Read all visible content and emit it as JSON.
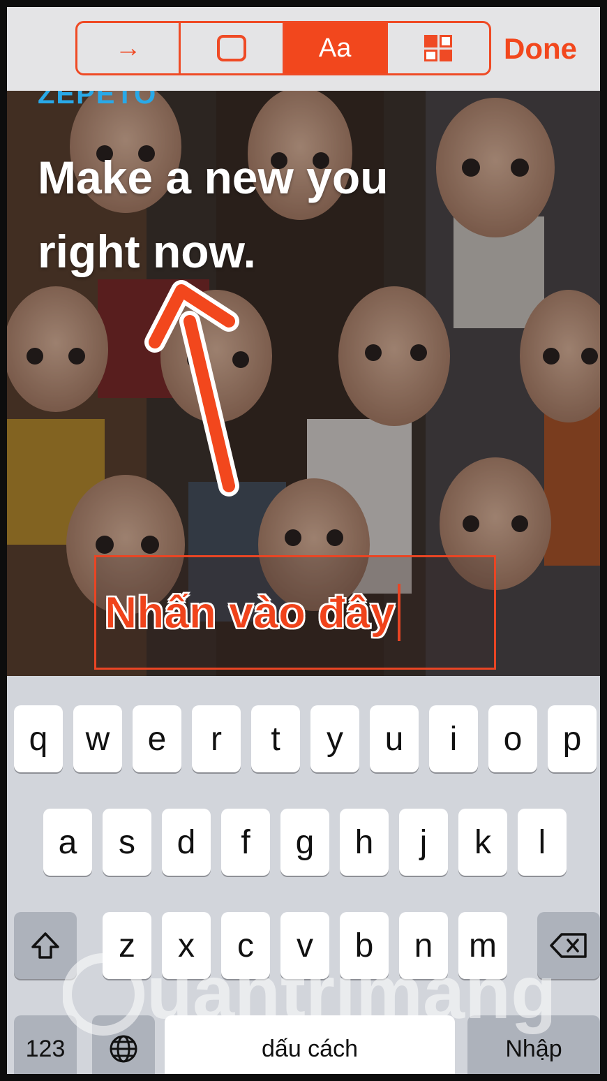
{
  "toolbar": {
    "buttons": [
      {
        "id": "arrow",
        "label": "→",
        "icon": "arrow-icon",
        "active": false
      },
      {
        "id": "box",
        "label": "",
        "icon": "rectangle-icon",
        "active": false
      },
      {
        "id": "text",
        "label": "Aa",
        "icon": "text-icon",
        "active": true
      },
      {
        "id": "pixelate",
        "label": "",
        "icon": "pixelate-icon",
        "active": false
      }
    ],
    "done_label": "Done"
  },
  "canvas": {
    "brand_text": "ZEPETO",
    "headline_line1": "Make a new you",
    "headline_line2": "right now.",
    "annotation_text": "Nhấn vào đây"
  },
  "keyboard": {
    "row1": [
      "q",
      "w",
      "e",
      "r",
      "t",
      "y",
      "u",
      "i",
      "o",
      "p"
    ],
    "row2": [
      "a",
      "s",
      "d",
      "f",
      "g",
      "h",
      "j",
      "k",
      "l"
    ],
    "row3": [
      "z",
      "x",
      "c",
      "v",
      "b",
      "n",
      "m"
    ],
    "numbers_label": "123",
    "space_label": "dấu cách",
    "return_label": "Nhập",
    "shift_icon": "shift-icon",
    "delete_icon": "backspace-icon",
    "globe_icon": "globe-icon"
  },
  "watermark_text": "uantrimang",
  "colors": {
    "accent": "#f2471d",
    "brand_blue": "#29a9e8",
    "keyboard_bg": "#d2d5db",
    "key_dark": "#adb2bb"
  }
}
